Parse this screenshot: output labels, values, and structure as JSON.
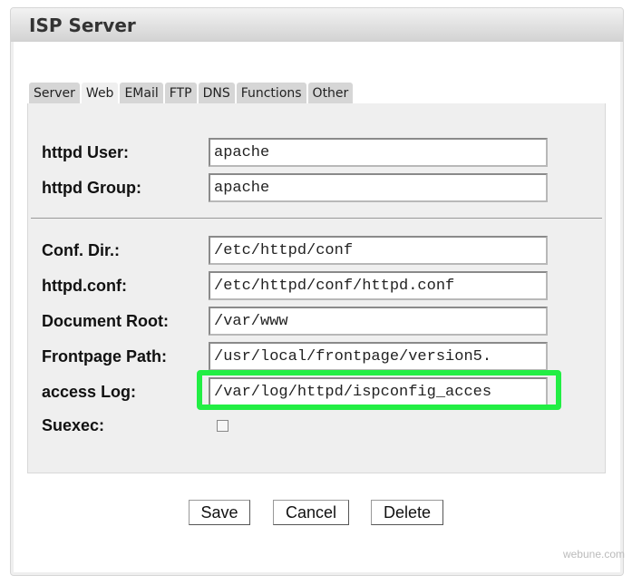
{
  "window": {
    "title": "ISP Server"
  },
  "tabs": [
    {
      "label": "Server",
      "active": false
    },
    {
      "label": "Web",
      "active": true
    },
    {
      "label": "EMail",
      "active": false
    },
    {
      "label": "FTP",
      "active": false
    },
    {
      "label": "DNS",
      "active": false
    },
    {
      "label": "Functions",
      "active": false
    },
    {
      "label": "Other",
      "active": false
    }
  ],
  "fields": {
    "httpd_user": {
      "label": "httpd User:",
      "value": "apache"
    },
    "httpd_group": {
      "label": "httpd Group:",
      "value": "apache"
    },
    "conf_dir": {
      "label": "Conf. Dir.:",
      "value": "/etc/httpd/conf"
    },
    "httpd_conf": {
      "label": "httpd.conf:",
      "value": "/etc/httpd/conf/httpd.conf"
    },
    "document_root": {
      "label": "Document Root:",
      "value": "/var/www"
    },
    "frontpage_path": {
      "label": "Frontpage Path:",
      "value": "/usr/local/frontpage/version5."
    },
    "access_log": {
      "label": "access Log:",
      "value": "/var/log/httpd/ispconfig_acces"
    },
    "suexec": {
      "label": "Suexec:",
      "checked": false
    }
  },
  "buttons": {
    "save": "Save",
    "cancel": "Cancel",
    "delete": "Delete"
  },
  "watermark": "webune.com",
  "highlight_color": "#22ee44"
}
